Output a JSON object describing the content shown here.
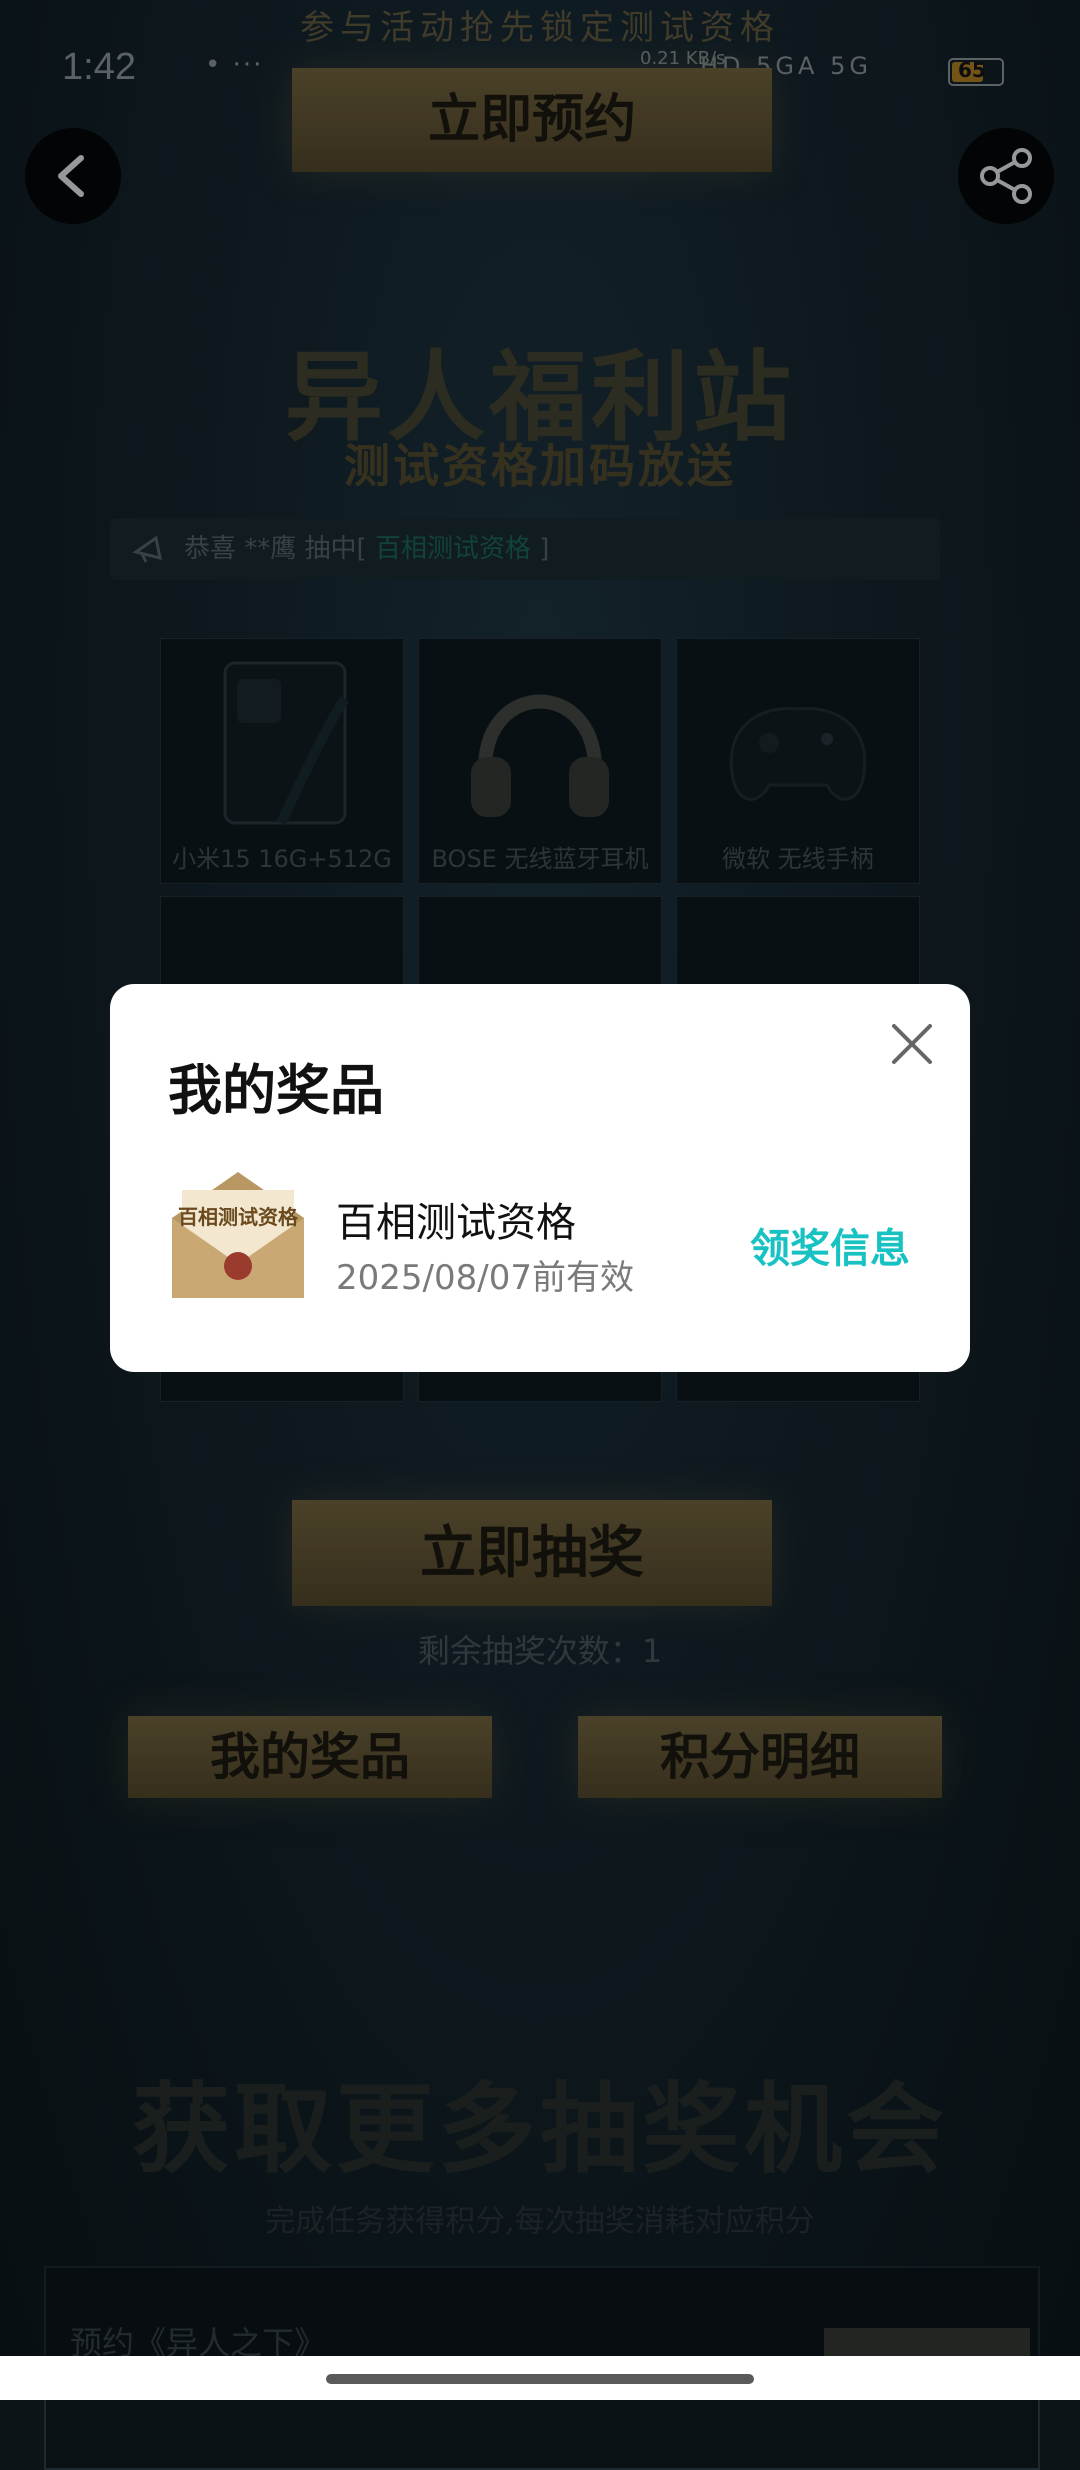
{
  "banner_top": "参与活动抢先锁定测试资格",
  "status_bar": {
    "time": "1:42",
    "dots": "• ···",
    "net_speed": "0.21 KB/s",
    "signals": "HD 5GA 5G",
    "battery": "65",
    "battery_level": 0.65
  },
  "reserve_button": "立即预约",
  "hero": {
    "title": "异人福利站",
    "subtitle": "测试资格加码放送"
  },
  "ticker": {
    "prefix": "恭喜 **鹰 抽中[ ",
    "highlight": "百相测试资格",
    "suffix": " ]"
  },
  "prizes": [
    {
      "label": "小米15 16G+512G"
    },
    {
      "label": "BOSE 无线蓝牙耳机"
    },
    {
      "label": "微软 无线手柄"
    }
  ],
  "draw_button": "立即抽奖",
  "remaining_draws": "剩余抽奖次数：1",
  "my_prizes_button": "我的奖品",
  "points_detail_button": "积分明细",
  "more_chances": {
    "title": "获取更多抽奖机会",
    "subtitle": "完成任务获得积分,每次抽奖消耗对应积分"
  },
  "task": {
    "label": "预约《异人之下》"
  },
  "modal": {
    "title": "我的奖品",
    "prize_name": "百相测试资格",
    "prize_validity": "2025/08/07前有效",
    "claim_link": "领奖信息",
    "prize_image_text": "百相测试资格"
  },
  "colors": {
    "accent": "#19c2c2",
    "gold": "#7e6a3f"
  }
}
